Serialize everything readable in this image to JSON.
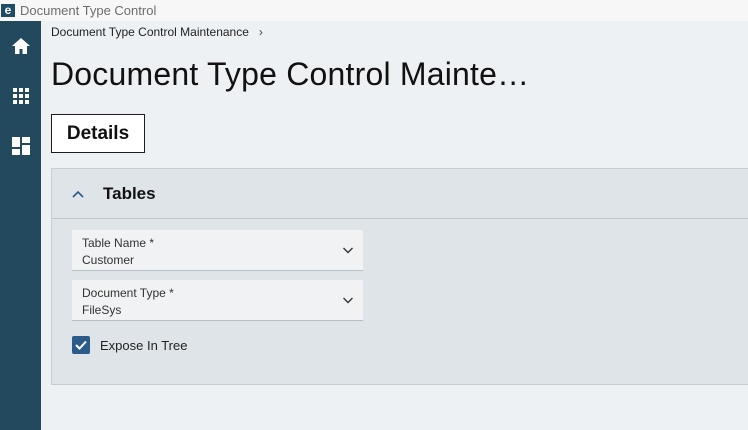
{
  "window": {
    "title": "Document Type Control",
    "logo_letter": "e"
  },
  "breadcrumb": {
    "items": [
      "Document Type Control Maintenance"
    ],
    "separator": "›"
  },
  "page": {
    "title": "Document Type Control Mainte…"
  },
  "tabs": [
    {
      "label": "Details",
      "active": true
    }
  ],
  "panel": {
    "title": "Tables",
    "expanded": true,
    "fields": [
      {
        "label": "Table Name *",
        "value": "Customer"
      },
      {
        "label": "Document Type *",
        "value": "FileSys"
      }
    ],
    "checkbox": {
      "label": "Expose In Tree",
      "checked": true
    }
  },
  "sidebar": {
    "icons": [
      "home-icon",
      "apps-grid-icon",
      "dashboard-icon"
    ]
  },
  "colors": {
    "sidebar": "#23495e",
    "panel": "#dfe4e8",
    "checkbox": "#2c5a8a",
    "background": "#eef1f4"
  }
}
